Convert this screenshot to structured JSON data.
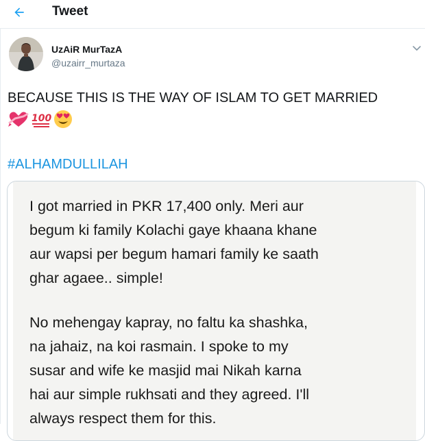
{
  "header": {
    "title": "Tweet",
    "back_icon": "back-arrow-icon",
    "accent": "#1da1f2"
  },
  "tweet": {
    "display_name": "UzAiR MurTazA",
    "handle": "@uzairr_murtaza",
    "text": "BECAUSE THIS IS THE WAY OF ISLAM TO GET MARRIED",
    "emojis": [
      "heart-with-ribbon-icon",
      "hundred-points-icon",
      "heart-eyes-face-icon"
    ],
    "hashtag": "#ALHAMDULLILAH",
    "hashtag_color": "#1b95e0",
    "caret_icon": "chevron-down-icon"
  },
  "media": {
    "lines": [
      "I got married in PKR 17,400 only. Meri aur",
      "begum ki family Kolachi gaye khaana khane",
      "aur wapsi per begum hamari family ke saath",
      "ghar agaee.. simple!",
      "",
      "No mehengay kapray, no faltu ka shashka,",
      "na jahaiz, na koi rasmain. I spoke to my",
      "susar and wife ke masjid mai Nikah karna",
      "hai aur simple rukhsati and they agreed. I'll",
      "always respect them for this."
    ]
  }
}
